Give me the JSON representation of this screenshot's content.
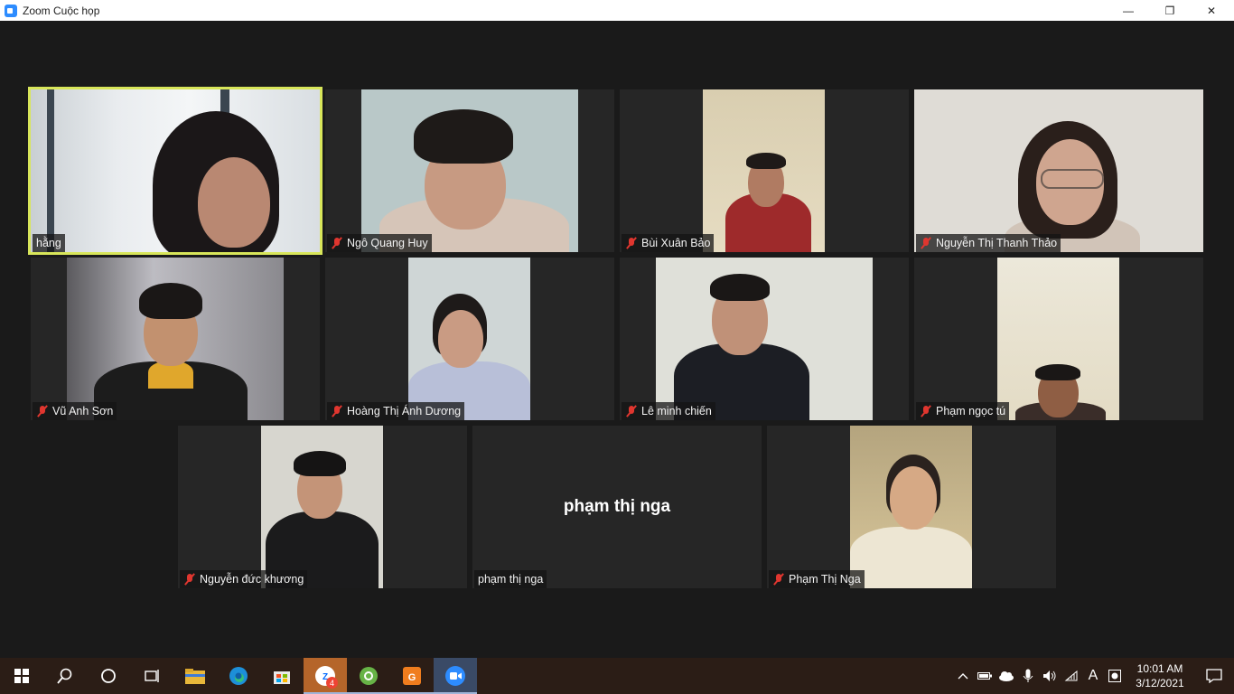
{
  "window": {
    "title": "Zoom Cuộc họp",
    "minimize": "—",
    "maximize": "❐",
    "close": "✕"
  },
  "participants": [
    {
      "name": "hằng",
      "muted": false,
      "active": true
    },
    {
      "name": "Ngô Quang Huy",
      "muted": true
    },
    {
      "name": "Bùi Xuân Bảo",
      "muted": true
    },
    {
      "name": "Nguyễn Thị Thanh Thảo",
      "muted": true
    },
    {
      "name": "Vũ Anh Sơn",
      "muted": true
    },
    {
      "name": "Hoàng Thị Ánh Dương",
      "muted": true
    },
    {
      "name": "Lê minh chiến",
      "muted": true
    },
    {
      "name": "Phạm ngọc tú",
      "muted": true
    },
    {
      "name": "Nguyễn đức khương",
      "muted": true
    },
    {
      "name": "phạm thị nga",
      "muted": false,
      "video": false,
      "display_name": "phạm thị nga"
    },
    {
      "name": "Phạm Thị Nga",
      "muted": true
    }
  ],
  "taskbar": {
    "apps": [
      "windows-start",
      "search",
      "cortana",
      "task-view",
      "file-explorer",
      "edge",
      "store",
      "zalo",
      "coccoc",
      "foxit-pdf",
      "zoom"
    ],
    "zalo_badge": "4",
    "ime": "A",
    "time": "10:01 AM",
    "date": "3/12/2021"
  },
  "colors": {
    "active_border": "#d8e65a",
    "mute_red": "#e0362f",
    "taskbar": "#2b1d16",
    "stage": "#1a1a1a"
  }
}
